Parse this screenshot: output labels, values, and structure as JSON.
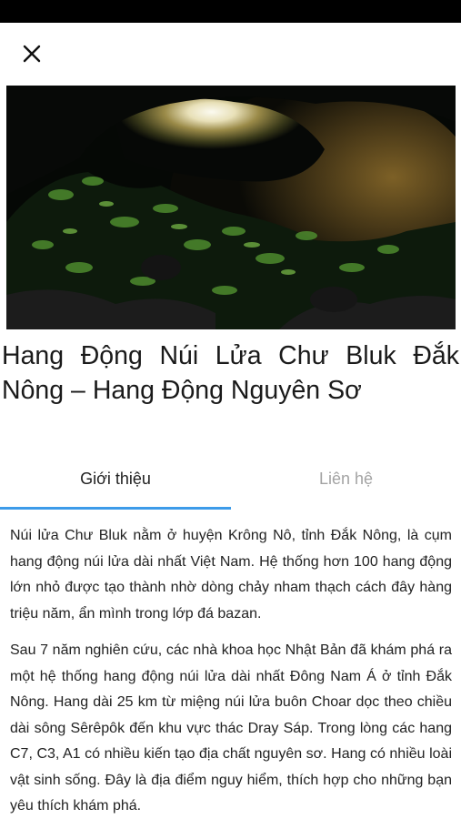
{
  "header": {
    "close_icon": "close-icon"
  },
  "hero": {
    "image": "cave-photo"
  },
  "title": "Hang Động Núi Lửa Chư Bluk Đắk Nông – Hang Động Nguyên Sơ",
  "tabs": [
    {
      "label": "Giới thiệu",
      "active": true
    },
    {
      "label": "Liên hệ",
      "active": false
    }
  ],
  "accent_color": "#3d9be9",
  "content": {
    "paragraphs": [
      "Núi lửa Chư Bluk nằm ở huyện Krông Nô, tỉnh Đắk Nông, là cụm hang động núi lửa dài nhất Việt Nam. Hệ thống hơn 100 hang động lớn nhỏ được tạo thành nhờ dòng chảy nham thạch cách đây hàng triệu năm, ẩn mình trong lớp đá bazan.",
      "Sau 7 năm nghiên cứu, các nhà khoa học Nhật Bản đã khám phá ra một hệ thống hang động núi lửa dài nhất Đông Nam Á ở tỉnh Đắk Nông. Hang dài 25 km từ miệng núi lửa buôn Choar dọc theo chiều dài sông Sêrêpôk đến khu vực thác Dray Sáp. Trong lòng các hang C7, C3, A1 có nhiều kiến tạo địa chất nguyên sơ. Hang có nhiều loài vật sinh sống. Đây là địa điểm nguy hiểm, thích hợp cho những bạn yêu thích khám phá."
    ]
  }
}
